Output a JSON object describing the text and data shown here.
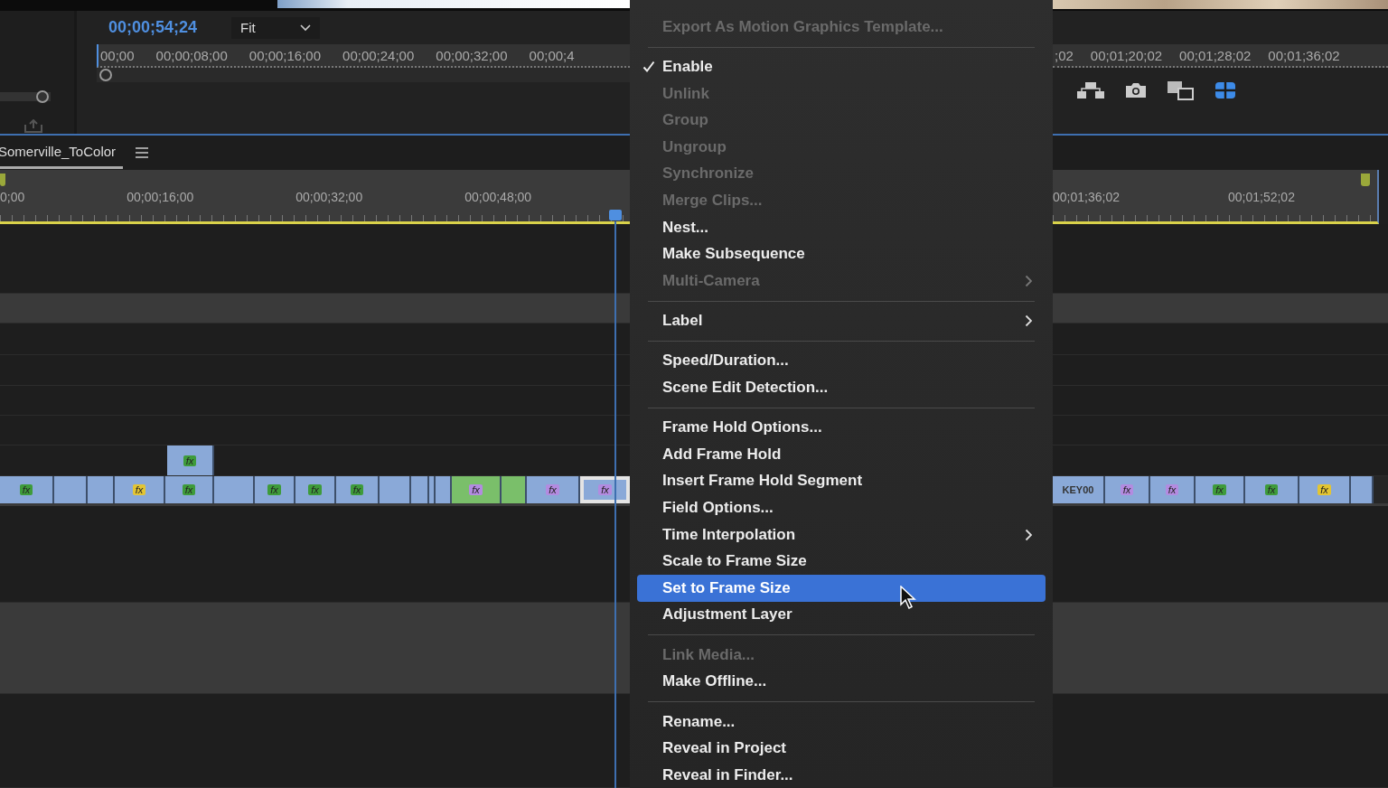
{
  "program_monitor": {
    "timecode": "00;00;54;24",
    "zoom_dropdown": "Fit",
    "ruler_left": [
      "00;00",
      "00;00;08;00",
      "00;00;16;00",
      "00;00;24;00",
      "00;00;32;00",
      "00;00;4"
    ],
    "ruler_right": [
      ";02",
      "00;01;20;02",
      "00;01;28;02",
      "00;01;36;02"
    ]
  },
  "timeline": {
    "tab": {
      "label": "Somerville_ToColor",
      "selected": true
    },
    "ruler_left": [
      "0;00",
      "00;00;16;00",
      "00;00;32;00",
      "00;00;48;00"
    ],
    "ruler_right": [
      "00;01;36;02",
      "00;01;52;02"
    ],
    "upper_clip": {
      "badge": "fx",
      "color": "#3e9b3a"
    },
    "clips_left": [
      {
        "kind": "video",
        "badge": "fx",
        "color": "#3e9b3a"
      },
      {
        "kind": "video"
      },
      {
        "kind": "video"
      },
      {
        "kind": "video",
        "badge": "fx",
        "color": "#e3c533"
      },
      {
        "kind": "video",
        "badge": "fx",
        "color": "#3e9b3a"
      },
      {
        "kind": "video"
      },
      {
        "kind": "video",
        "badge": "fx",
        "color": "#3e9b3a"
      },
      {
        "kind": "video",
        "badge": "fx",
        "color": "#3e9b3a"
      },
      {
        "kind": "video",
        "badge": "fx",
        "color": "#3e9b3a"
      },
      {
        "kind": "video"
      },
      {
        "kind": "video"
      },
      {
        "kind": "video"
      },
      {
        "kind": "video"
      },
      {
        "kind": "green",
        "badge": "fx",
        "color": "#b38be0"
      },
      {
        "kind": "green"
      },
      {
        "kind": "video",
        "badge": "fx",
        "color": "#b38be0"
      },
      {
        "kind": "selected",
        "badge": "fx",
        "color": "#b38be0"
      }
    ],
    "clips_right": [
      {
        "kind": "video",
        "label": "KEY00"
      },
      {
        "kind": "video",
        "badge": "fx",
        "color": "#b38be0"
      },
      {
        "kind": "video",
        "badge": "fx",
        "color": "#b38be0"
      },
      {
        "kind": "video",
        "badge": "fx",
        "color": "#3e9b3a"
      },
      {
        "kind": "video",
        "badge": "fx",
        "color": "#3e9b3a"
      },
      {
        "kind": "video",
        "badge": "fx",
        "color": "#e3c533"
      },
      {
        "kind": "video"
      }
    ]
  },
  "context_menu": [
    {
      "kind": "item",
      "label": "Export As Motion Graphics Template...",
      "disabled": true,
      "checked": false,
      "submenu": false,
      "selected": false
    },
    {
      "kind": "separator"
    },
    {
      "kind": "item",
      "label": "Enable",
      "disabled": false,
      "checked": true,
      "submenu": false,
      "selected": false
    },
    {
      "kind": "item",
      "label": "Unlink",
      "disabled": true,
      "checked": false,
      "submenu": false,
      "selected": false
    },
    {
      "kind": "item",
      "label": "Group",
      "disabled": true,
      "checked": false,
      "submenu": false,
      "selected": false
    },
    {
      "kind": "item",
      "label": "Ungroup",
      "disabled": true,
      "checked": false,
      "submenu": false,
      "selected": false
    },
    {
      "kind": "item",
      "label": "Synchronize",
      "disabled": true,
      "checked": false,
      "submenu": false,
      "selected": false
    },
    {
      "kind": "item",
      "label": "Merge Clips...",
      "disabled": true,
      "checked": false,
      "submenu": false,
      "selected": false
    },
    {
      "kind": "item",
      "label": "Nest...",
      "disabled": false,
      "checked": false,
      "submenu": false,
      "selected": false
    },
    {
      "kind": "item",
      "label": "Make Subsequence",
      "disabled": false,
      "checked": false,
      "submenu": false,
      "selected": false
    },
    {
      "kind": "item",
      "label": "Multi-Camera",
      "disabled": true,
      "checked": false,
      "submenu": true,
      "selected": false
    },
    {
      "kind": "separator"
    },
    {
      "kind": "item",
      "label": "Label",
      "disabled": false,
      "checked": false,
      "submenu": true,
      "selected": false
    },
    {
      "kind": "separator"
    },
    {
      "kind": "item",
      "label": "Speed/Duration...",
      "disabled": false,
      "checked": false,
      "submenu": false,
      "selected": false
    },
    {
      "kind": "item",
      "label": "Scene Edit Detection...",
      "disabled": false,
      "checked": false,
      "submenu": false,
      "selected": false
    },
    {
      "kind": "separator"
    },
    {
      "kind": "item",
      "label": "Frame Hold Options...",
      "disabled": false,
      "checked": false,
      "submenu": false,
      "selected": false
    },
    {
      "kind": "item",
      "label": "Add Frame Hold",
      "disabled": false,
      "checked": false,
      "submenu": false,
      "selected": false
    },
    {
      "kind": "item",
      "label": "Insert Frame Hold Segment",
      "disabled": false,
      "checked": false,
      "submenu": false,
      "selected": false
    },
    {
      "kind": "item",
      "label": "Field Options...",
      "disabled": false,
      "checked": false,
      "submenu": false,
      "selected": false
    },
    {
      "kind": "item",
      "label": "Time Interpolation",
      "disabled": false,
      "checked": false,
      "submenu": true,
      "selected": false
    },
    {
      "kind": "item",
      "label": "Scale to Frame Size",
      "disabled": false,
      "checked": false,
      "submenu": false,
      "selected": false
    },
    {
      "kind": "item",
      "label": "Set to Frame Size",
      "disabled": false,
      "checked": false,
      "submenu": false,
      "selected": true
    },
    {
      "kind": "item",
      "label": "Adjustment Layer",
      "disabled": false,
      "checked": false,
      "submenu": false,
      "selected": false
    },
    {
      "kind": "separator"
    },
    {
      "kind": "item",
      "label": "Link Media...",
      "disabled": true,
      "checked": false,
      "submenu": false,
      "selected": false
    },
    {
      "kind": "item",
      "label": "Make Offline...",
      "disabled": false,
      "checked": false,
      "submenu": false,
      "selected": false
    },
    {
      "kind": "separator"
    },
    {
      "kind": "item",
      "label": "Rename...",
      "disabled": false,
      "checked": false,
      "submenu": false,
      "selected": false
    },
    {
      "kind": "item",
      "label": "Reveal in Project",
      "disabled": false,
      "checked": false,
      "submenu": false,
      "selected": false
    },
    {
      "kind": "item",
      "label": "Reveal in Finder...",
      "disabled": false,
      "checked": false,
      "submenu": false,
      "selected": false
    }
  ]
}
